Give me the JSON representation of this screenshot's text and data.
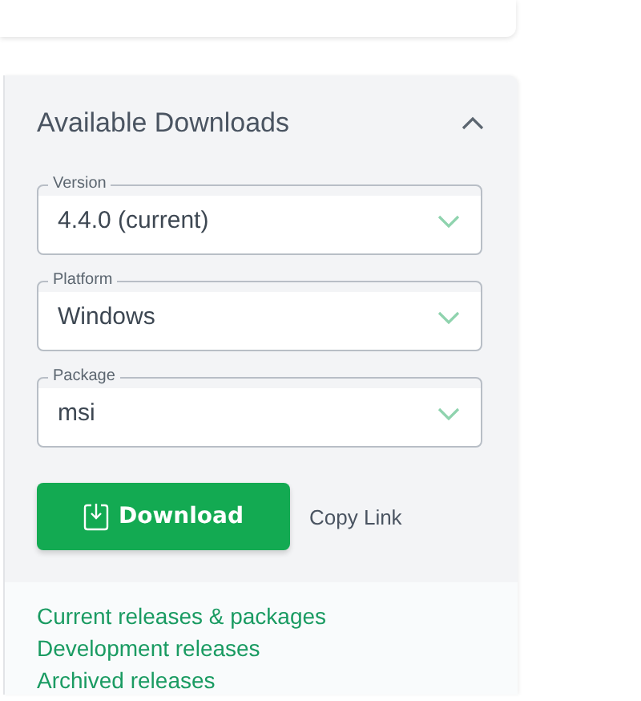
{
  "panel": {
    "title": "Available Downloads",
    "expanded": true
  },
  "fields": [
    {
      "label": "Version",
      "value": "4.4.0 (current)"
    },
    {
      "label": "Platform",
      "value": "Windows"
    },
    {
      "label": "Package",
      "value": "msi"
    }
  ],
  "download_button": "Download",
  "copy_link": "Copy Link",
  "links": [
    "Current releases & packages",
    "Development releases",
    "Archived releases"
  ]
}
